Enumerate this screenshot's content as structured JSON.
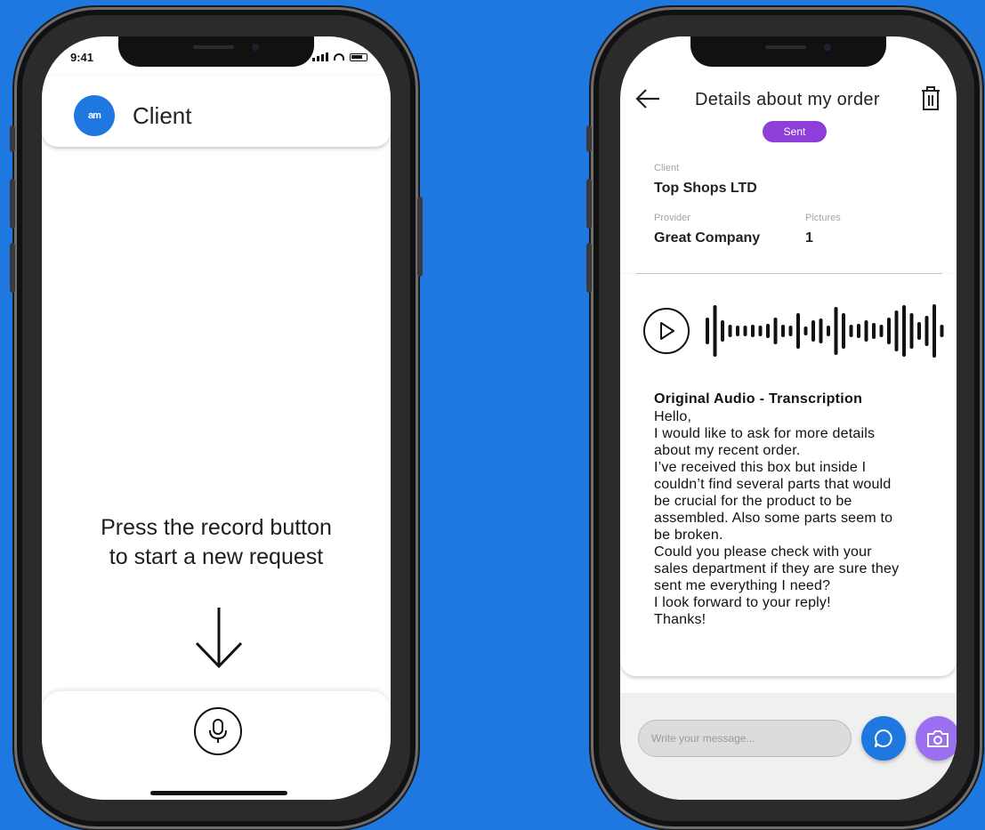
{
  "left_phone": {
    "status_time": "9:41",
    "app_title": "Client",
    "logo_text": "am",
    "prompt_lines": [
      "Press the record button",
      "to start a new request"
    ],
    "icons": {
      "arrow": "arrow-down-icon",
      "mic": "microphone-icon"
    }
  },
  "right_phone": {
    "title": "Details about my order",
    "status_badge": "Sent",
    "client_label": "Client",
    "client_value": "Top Shops LTD",
    "provider_label": "Provider",
    "provider_value": "Great Company",
    "pictures_label": "Pictures",
    "pictures_value": "1",
    "transcription_title": "Original Audio - Transcription",
    "transcription_lines": [
      "Hello,",
      "I would like to ask for more details",
      "about my recent order.",
      "I’ve received this box but inside I",
      "couldn’t find several parts that would",
      "be crucial for the product to be",
      "assembled. Also some parts seem to",
      "be broken.",
      "Could you please check with your",
      "sales department if they are sure they",
      "sent me everything I need?",
      "I look forward to your reply!",
      "Thanks!"
    ],
    "message_placeholder": "Write your message...",
    "icons": {
      "back": "arrow-left-icon",
      "delete": "trash-icon",
      "play": "play-icon",
      "chat": "chat-bubble-icon",
      "camera": "camera-icon"
    }
  },
  "colors": {
    "background": "#1f78e0",
    "badge": "#8e3fd9",
    "chat_button": "#1f78e0",
    "camera_button": "#9a6ff0"
  }
}
